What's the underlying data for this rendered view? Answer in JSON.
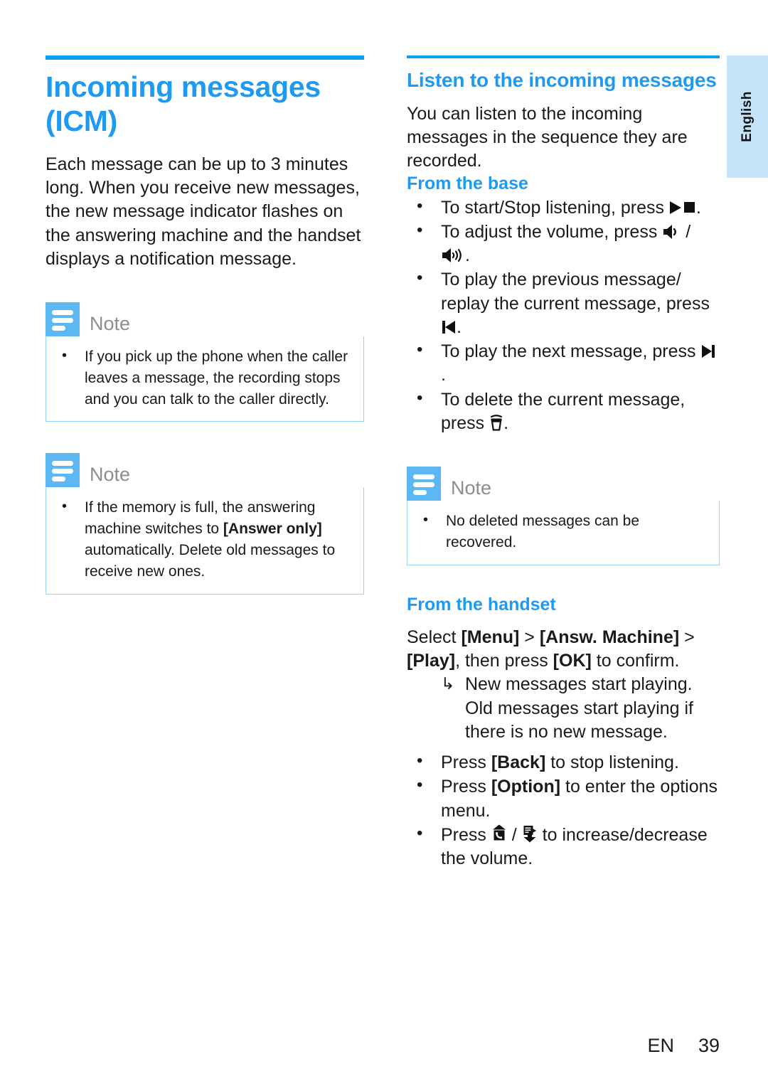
{
  "page": {
    "language_tab": "English",
    "footer_locale": "EN",
    "footer_page_number": "39",
    "accent_color": "#1f9af0",
    "rule_color": "#0c9bf4",
    "note_icon_color": "#5cb8f2",
    "note_border_color": "#96d4f6",
    "tab_background": "#c5e3f8"
  },
  "left_column": {
    "chapter_title": "Incoming messages (ICM)",
    "intro_paragraph": "Each message can be up to 3 minutes long. When you receive new messages, the new message indicator flashes on the answering machine and the handset displays a notification message.",
    "notes": [
      {
        "title": "Note",
        "icon": "note-lines-icon",
        "items": [
          "If you pick up the phone when the caller leaves a message, the recording stops and you can talk to the caller directly."
        ]
      },
      {
        "title": "Note",
        "icon": "note-lines-icon",
        "items_rich": [
          {
            "pre": "If the memory is full, the answering machine switches to ",
            "bold": "[Answer only]",
            "post": " automatically. Delete old messages to receive new ones."
          }
        ]
      }
    ]
  },
  "right_column": {
    "section_title": "Listen to the incoming messages",
    "intro_paragraph": "You can listen to the incoming messages in the sequence they are recorded.",
    "from_base": {
      "heading": "From the base",
      "bullets": [
        {
          "pre": "To start/Stop listening, press ",
          "icon": "play-stop-icon",
          "post": "."
        },
        {
          "pre": "To adjust the volume, press ",
          "icon": "volume-down-icon",
          "mid": " / ",
          "icon2": "volume-up-icon",
          "post": "."
        },
        {
          "pre": "To play the previous message/ replay the current message, press ",
          "icon": "previous-track-icon",
          "post": "."
        },
        {
          "pre": "To play the next message, press ",
          "icon": "next-track-icon",
          "post": "."
        },
        {
          "pre": "To delete the current message, press ",
          "icon": "trash-icon",
          "post": "."
        }
      ]
    },
    "note": {
      "title": "Note",
      "icon": "note-lines-icon",
      "items": [
        "No deleted messages can be recovered."
      ]
    },
    "from_handset": {
      "heading": "From the handset",
      "instruction": {
        "s1": "Select ",
        "k1": "[Menu]",
        "s2": " > ",
        "k2": "[Answ. Machine]",
        "s3": " > ",
        "k3": "[Play]",
        "s4": ", then press ",
        "k4": "[OK]",
        "s5": " to confirm."
      },
      "results": [
        "New messages start playing. Old messages start playing if there is no new message."
      ],
      "bullets": [
        {
          "pre": "Press ",
          "bold": "[Back]",
          "post": " to stop listening."
        },
        {
          "pre": "Press ",
          "bold": "[Option]",
          "post": " to enter the options menu."
        },
        {
          "pre": "Press ",
          "icon": "handset-volume-up-icon",
          "mid": " / ",
          "icon2": "handset-volume-down-icon",
          "post": " to increase/decrease the volume."
        }
      ]
    }
  }
}
